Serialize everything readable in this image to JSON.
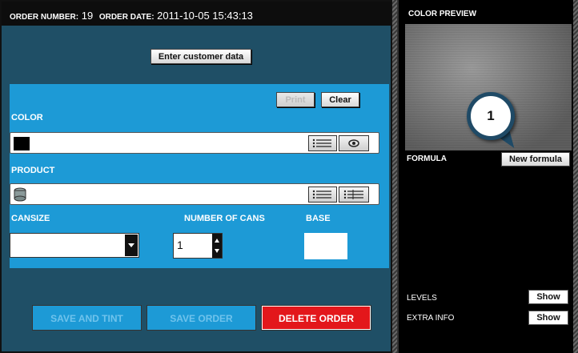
{
  "order": {
    "number_label": "ORDER NUMBER:",
    "number_value": "19",
    "date_label": "ORDER DATE:",
    "date_value": "2011-10-05 15:43:13"
  },
  "buttons": {
    "enter_customer": "Enter customer data",
    "print": "Print",
    "clear": "Clear",
    "save_and_tint": "SAVE AND TINT",
    "save_order": "SAVE ORDER",
    "delete_order": "DELETE ORDER"
  },
  "form": {
    "color_label": "COLOR",
    "product_label": "PRODUCT",
    "cansize_label": "CANSIZE",
    "cans_label": "NUMBER OF CANS",
    "cans_value": "1",
    "base_label": "BASE"
  },
  "right": {
    "preview_title": "COLOR PREVIEW",
    "formula_label": "FORMULA",
    "new_formula": "New formula",
    "levels_label": "LEVELS",
    "extra_info_label": "EXTRA INFO",
    "show": "Show",
    "callout_number": "1"
  },
  "colors": {
    "panel_bg": "#1f4f66",
    "section_blue": "#1d9ad6",
    "delete_red": "#e3171b"
  }
}
